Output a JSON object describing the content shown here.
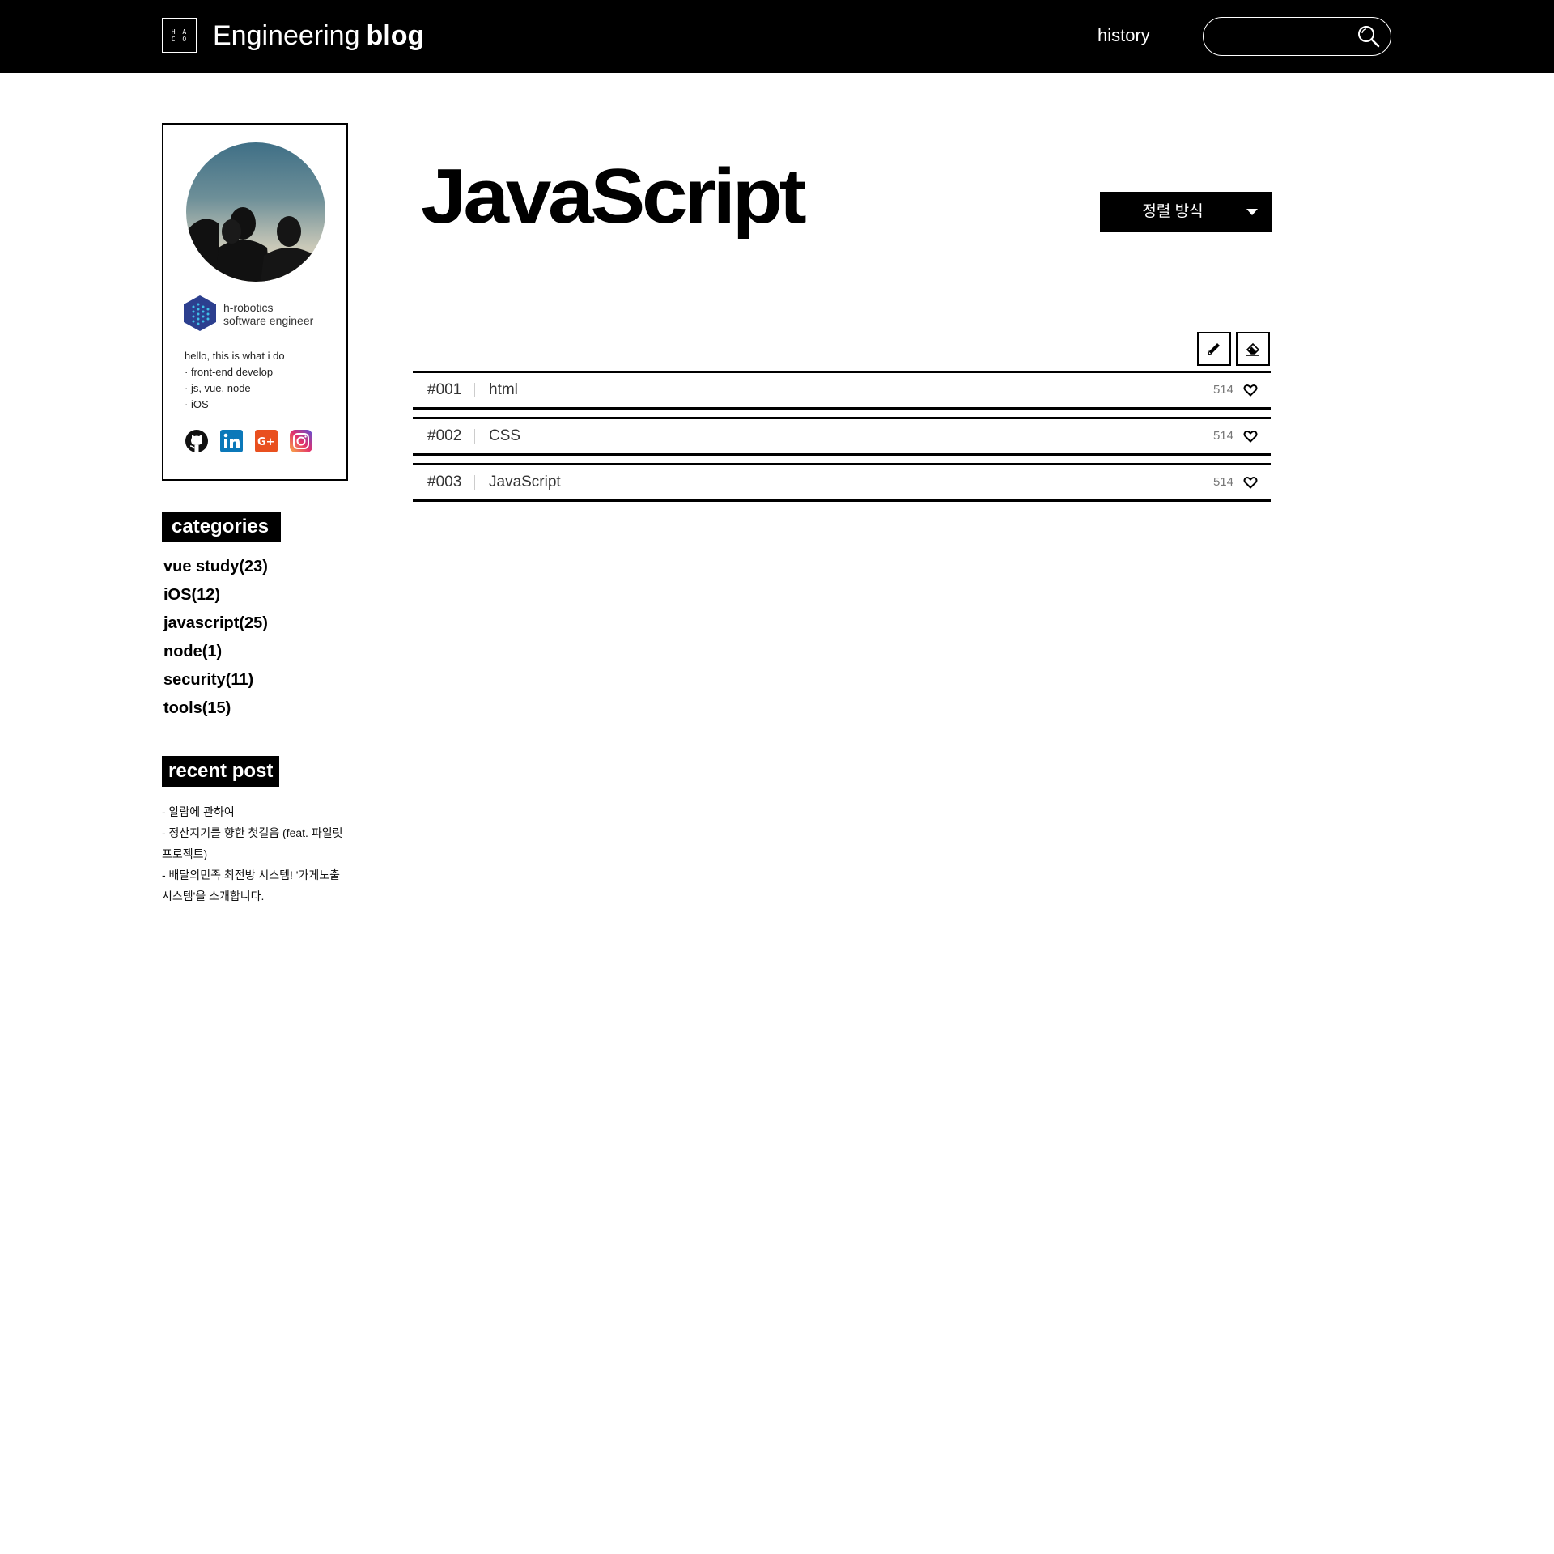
{
  "header": {
    "logo_text": "H A\nC O",
    "title_light": "Engineering",
    "title_bold": "blog",
    "nav_history": "history",
    "search_placeholder": ""
  },
  "profile": {
    "company": "h-robotics",
    "role": "software engineer",
    "bio": [
      "hello, this is what i do",
      "· front-end develop",
      "· js, vue, node",
      "· iOS"
    ],
    "social": [
      "github-icon",
      "linkedin-icon",
      "google-plus-icon",
      "instagram-icon"
    ]
  },
  "categories": {
    "label": "categories",
    "items": [
      "vue study(23)",
      "iOS(12)",
      "javascript(25)",
      "node(1)",
      "security(11)",
      "tools(15)"
    ]
  },
  "recent": {
    "label": "recent post",
    "items": [
      "- 알람에 관하여",
      "- 정산지기를 향한 첫걸음 (feat. 파일럿 프로젝트)",
      "- 배달의민족 최전방  시스템! '가게노출 시스템'을 소개합니다."
    ]
  },
  "main": {
    "title": "JavaScript",
    "sort_label": "정렬 방식",
    "posts": [
      {
        "num": "#001",
        "title": "html",
        "likes": "514"
      },
      {
        "num": "#002",
        "title": "CSS",
        "likes": "514"
      },
      {
        "num": "#003",
        "title": "JavaScript",
        "likes": "514"
      }
    ]
  },
  "colors": {
    "header_bg": "#000000",
    "accent": "#000000",
    "background": "#ffffff"
  }
}
